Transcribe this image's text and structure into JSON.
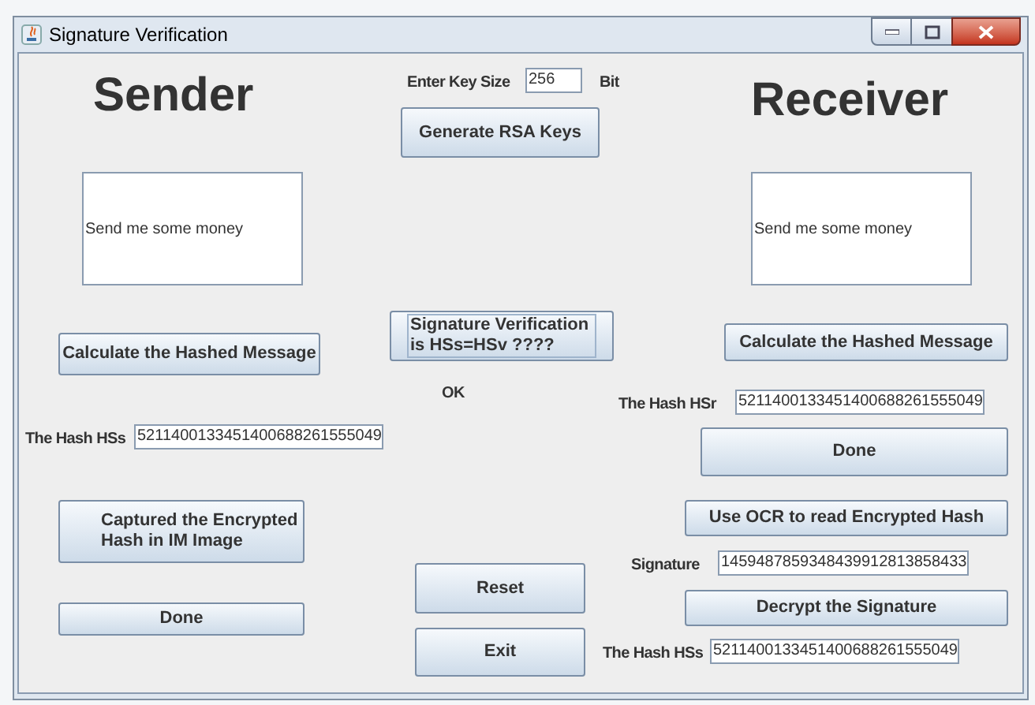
{
  "window": {
    "title": "Signature Verification"
  },
  "sender": {
    "heading": "Sender",
    "message": "Send me some money",
    "hash_button": "Calculate the Hashed Message",
    "hash_label": "The Hash HSs",
    "hash_value": "5211400133451400688261555049",
    "capture_button": "Captured the Encrypted Hash in IM Image",
    "done_button": "Done"
  },
  "center": {
    "key_size_label": "Enter Key Size",
    "key_size": "256",
    "key_unit": "Bit",
    "generate_button": "Generate RSA Keys",
    "verify_button": "Signature Verification is HSs=HSv ????",
    "result": "OK",
    "reset_button": "Reset",
    "exit_button": "Exit"
  },
  "receiver": {
    "heading": "Receiver",
    "message": "Send me some money",
    "hash_button": "Calculate the Hashed Message",
    "hash_label": "The Hash HSr",
    "hash_value": "5211400133451400688261555049",
    "done_button": "Done",
    "ocr_button": "Use OCR to read Encrypted Hash",
    "signature_label": "Signature",
    "signature_value": "1459487859348439912813858433",
    "decrypt_button": "Decrypt the Signature",
    "decrypted_label": "The Hash HSs",
    "decrypted_value": "5211400133451400688261555049"
  }
}
